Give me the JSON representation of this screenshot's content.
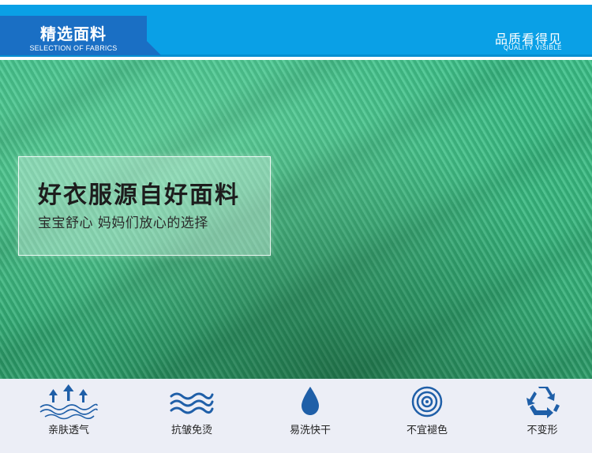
{
  "header": {
    "badge_title": "精选面料",
    "badge_subtitle": "SELECTION OF FABRICS",
    "quality_title": "品质看得见",
    "quality_subtitle": "QUALITY VISIBLE"
  },
  "hero": {
    "title": "好衣服源自好面料",
    "subtitle": "宝宝舒心 妈妈们放心的选择"
  },
  "features": [
    {
      "label": "亲肤透气",
      "icon": "breathable-icon"
    },
    {
      "label": "抗皱免烫",
      "icon": "waves-icon"
    },
    {
      "label": "易洗快干",
      "icon": "water-drop-icon"
    },
    {
      "label": "不宜褪色",
      "icon": "target-icon"
    },
    {
      "label": "不变形",
      "icon": "recycle-icon"
    }
  ],
  "colors": {
    "header_blue": "#0aa0e6",
    "badge_blue": "#1a6fc4",
    "fabric_green": "#3cbc84",
    "icon_blue": "#1f5fa8",
    "strip_bg": "#eceef6"
  }
}
